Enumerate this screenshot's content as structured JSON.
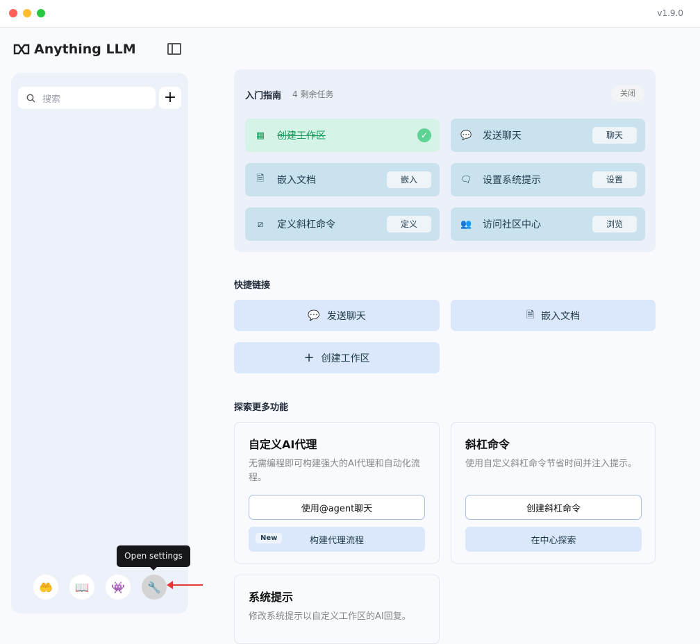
{
  "window": {
    "version": "v1.9.0"
  },
  "logo": {
    "text": "Anything LLM"
  },
  "sidebar": {
    "search_placeholder": "搜索",
    "tooltip": "Open settings"
  },
  "guide": {
    "title": "入门指南",
    "remaining": "4 剩余任务",
    "close": "关闭",
    "tasks": [
      {
        "label": "创建工作区",
        "done": true
      },
      {
        "label": "发送聊天",
        "button": "聊天"
      },
      {
        "label": "嵌入文档",
        "button": "嵌入"
      },
      {
        "label": "设置系统提示",
        "button": "设置"
      },
      {
        "label": "定义斜杠命令",
        "button": "定义"
      },
      {
        "label": "访问社区中心",
        "button": "浏览"
      }
    ]
  },
  "quick_links": {
    "title": "快捷链接",
    "items": [
      {
        "label": "发送聊天"
      },
      {
        "label": "嵌入文档"
      },
      {
        "label": "创建工作区"
      }
    ]
  },
  "explore": {
    "title": "探索更多功能",
    "cards": [
      {
        "title": "自定义AI代理",
        "desc": "无需编程即可构建强大的AI代理和自动化流程。",
        "primary": "使用@agent聊天",
        "secondary": "构建代理流程",
        "badge": "New"
      },
      {
        "title": "斜杠命令",
        "desc": "使用自定义斜杠命令节省时间并注入提示。",
        "primary": "创建斜杠命令",
        "secondary": "在中心探索"
      },
      {
        "title": "系统提示",
        "desc": "修改系统提示以自定义工作区的AI回复。"
      }
    ]
  }
}
